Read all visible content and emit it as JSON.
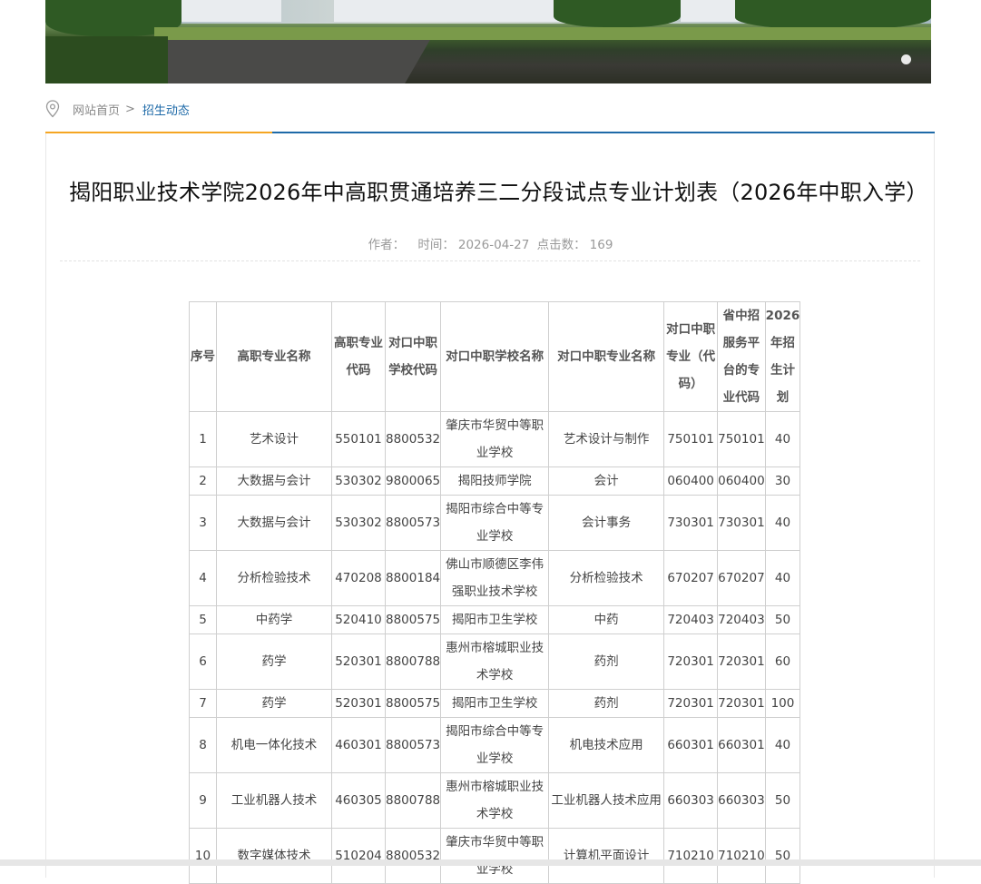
{
  "breadcrumb": {
    "home": "网站首页",
    "separator": ">",
    "current": "招生动态"
  },
  "article": {
    "title": "揭阳职业技术学院2026年中高职贯通培养三二分段试点专业计划表（2026年中职入学）",
    "author_label": "作者：",
    "time_label": "时间：",
    "time_value": "2026-04-27",
    "clicks_label": "点击数：",
    "clicks_value": "169"
  },
  "table": {
    "headers": [
      "序号",
      "高职专业名称",
      "高职专业代码",
      "对口中职学校代码",
      "对口中职学校名称",
      "对口中职专业名称",
      "对口中职专业（代码）",
      "省中招服务平台的专业代码",
      "2026年招生计划"
    ],
    "rows": [
      [
        "1",
        "艺术设计",
        "550101",
        "8800532",
        "肇庆市华贸中等职业学校",
        "艺术设计与制作",
        "750101",
        "750101",
        "40"
      ],
      [
        "2",
        "大数据与会计",
        "530302",
        "9800065",
        "揭阳技师学院",
        "会计",
        "060400",
        "060400",
        "30"
      ],
      [
        "3",
        "大数据与会计",
        "530302",
        "8800573",
        "揭阳市综合中等专业学校",
        "会计事务",
        "730301",
        "730301",
        "40"
      ],
      [
        "4",
        "分析检验技术",
        "470208",
        "8800184",
        "佛山市顺德区李伟强职业技术学校",
        "分析检验技术",
        "670207",
        "670207",
        "40"
      ],
      [
        "5",
        "中药学",
        "520410",
        "8800575",
        "揭阳市卫生学校",
        "中药",
        "720403",
        "720403",
        "50"
      ],
      [
        "6",
        "药学",
        "520301",
        "8800788",
        "惠州市榕城职业技术学校",
        "药剂",
        "720301",
        "720301",
        "60"
      ],
      [
        "7",
        "药学",
        "520301",
        "8800575",
        "揭阳市卫生学校",
        "药剂",
        "720301",
        "720301",
        "100"
      ],
      [
        "8",
        "机电一体化技术",
        "460301",
        "8800573",
        "揭阳市综合中等专业学校",
        "机电技术应用",
        "660301",
        "660301",
        "40"
      ],
      [
        "9",
        "工业机器人技术",
        "460305",
        "8800788",
        "惠州市榕城职业技术学校",
        "工业机器人技术应用",
        "660303",
        "660303",
        "50"
      ],
      [
        "10",
        "数字媒体技术",
        "510204",
        "8800532",
        "肇庆市华贸中等职业学校",
        "计算机平面设计",
        "710210",
        "710210",
        "50"
      ]
    ]
  }
}
